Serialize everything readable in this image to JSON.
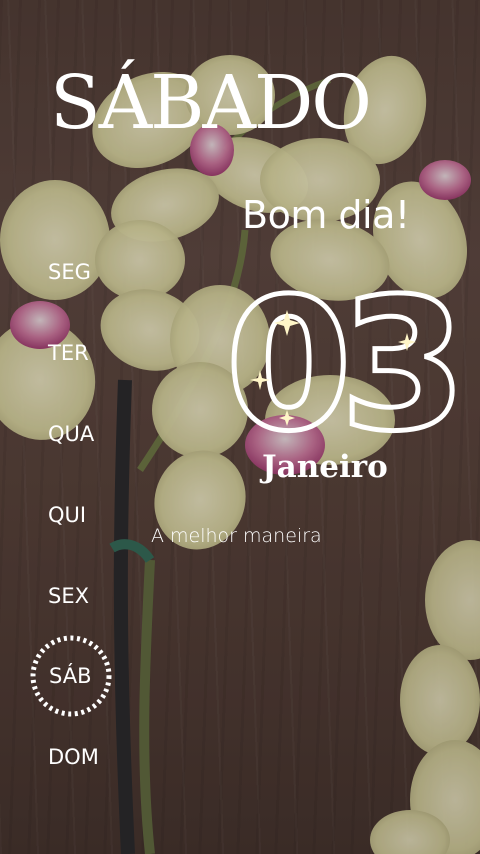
{
  "header": {
    "day_title": "SÁBADO",
    "greeting": "Bom dia!"
  },
  "date": {
    "day_number": "03",
    "month": "Janeiro"
  },
  "tagline": "A melhor maneira",
  "week": {
    "days": [
      "SEG",
      "TER",
      "QUA",
      "QUI",
      "SEX",
      "SÁB",
      "DOM"
    ],
    "selected": "SÁB"
  },
  "colors": {
    "text": "#ffffff",
    "background": "#4d3b35",
    "petal": "#e4e2b0",
    "accent": "#c24a8a"
  }
}
